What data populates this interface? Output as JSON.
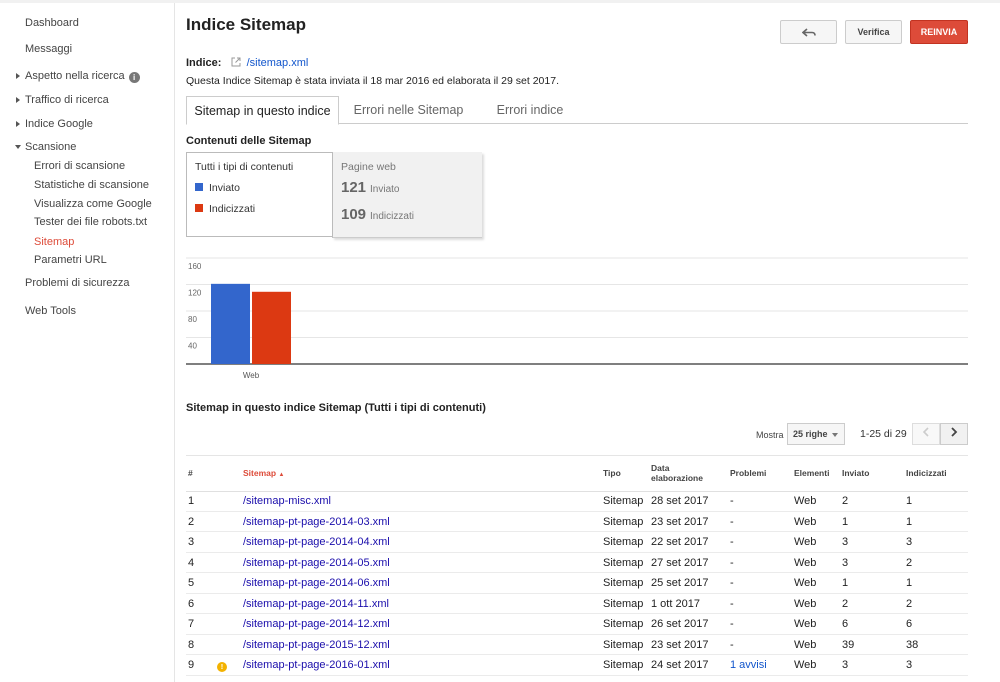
{
  "sidebar": {
    "items": [
      {
        "label": "Dashboard"
      },
      {
        "label": "Messaggi"
      },
      {
        "label": "Aspetto nella ricerca"
      },
      {
        "label": "Traffico di ricerca"
      },
      {
        "label": "Indice Google"
      },
      {
        "label": "Scansione"
      },
      {
        "label": "Problemi di sicurezza"
      },
      {
        "label": "Web Tools"
      }
    ],
    "scansione_sub": [
      {
        "label": "Errori di scansione"
      },
      {
        "label": "Statistiche di scansione"
      },
      {
        "label": "Visualizza come Google"
      },
      {
        "label": "Tester dei file robots.txt"
      },
      {
        "label": "Sitemap"
      },
      {
        "label": "Parametri URL"
      }
    ],
    "info_glyph": "i"
  },
  "header": {
    "title": "Indice Sitemap",
    "verify_label": "Verifica",
    "resend_label": "REINVIA"
  },
  "index": {
    "label": "Indice:",
    "file": "/sitemap.xml",
    "submitted_text": "Questa Indice Sitemap è stata inviata il 18 mar 2016 ed elaborata il 29 set 2017."
  },
  "tabs": [
    {
      "label": "Sitemap in questo indice",
      "active": true
    },
    {
      "label": "Errori nelle Sitemap",
      "active": false
    },
    {
      "label": "Errori indice",
      "active": false
    }
  ],
  "contents": {
    "title": "Contenuti delle Sitemap",
    "legend_title": "Tutti i tipi di contenuti",
    "legend_submitted": "Inviato",
    "legend_indexed": "Indicizzati",
    "web_title": "Pagine web",
    "web_submitted_value": "121",
    "web_submitted_label": "Inviato",
    "web_indexed_value": "109",
    "web_indexed_label": "Indicizzati"
  },
  "colors": {
    "submitted": "#3366cc",
    "indexed": "#dc3912",
    "accent": "#dd4b39",
    "link": "#1a0dab"
  },
  "chart_data": {
    "type": "bar",
    "categories": [
      "Web"
    ],
    "series": [
      {
        "name": "Inviato",
        "values": [
          121
        ]
      },
      {
        "name": "Indicizzati",
        "values": [
          109
        ]
      }
    ],
    "yticks": [
      40,
      80,
      120,
      160
    ],
    "ylim": [
      0,
      160
    ],
    "grid": true
  },
  "table": {
    "title": "Sitemap in questo indice Sitemap (Tutti i tipi di contenuti)",
    "show_label": "Mostra",
    "rows_select": "25 righe",
    "page_range": "1-25 di 29",
    "headers": {
      "num": "#",
      "sitemap": "Sitemap",
      "sort_arrow": "▲",
      "tipo": "Tipo",
      "data_line1": "Data",
      "data_line2": "elaborazione",
      "problemi": "Problemi",
      "elementi": "Elementi",
      "inviato": "Inviato",
      "indicizzati": "Indicizzati"
    },
    "rows": [
      {
        "num": "1",
        "warn": "",
        "sitemap": "/sitemap-misc.xml",
        "tipo": "Sitemap",
        "date": "28 set 2017",
        "problems": "-",
        "elements": "Web",
        "submitted": "2",
        "indexed": "1"
      },
      {
        "num": "2",
        "warn": "",
        "sitemap": "/sitemap-pt-page-2014-03.xml",
        "tipo": "Sitemap",
        "date": "23 set 2017",
        "problems": "-",
        "elements": "Web",
        "submitted": "1",
        "indexed": "1"
      },
      {
        "num": "3",
        "warn": "",
        "sitemap": "/sitemap-pt-page-2014-04.xml",
        "tipo": "Sitemap",
        "date": "22 set 2017",
        "problems": "-",
        "elements": "Web",
        "submitted": "3",
        "indexed": "3"
      },
      {
        "num": "4",
        "warn": "",
        "sitemap": "/sitemap-pt-page-2014-05.xml",
        "tipo": "Sitemap",
        "date": "27 set 2017",
        "problems": "-",
        "elements": "Web",
        "submitted": "3",
        "indexed": "2"
      },
      {
        "num": "5",
        "warn": "",
        "sitemap": "/sitemap-pt-page-2014-06.xml",
        "tipo": "Sitemap",
        "date": "25 set 2017",
        "problems": "-",
        "elements": "Web",
        "submitted": "1",
        "indexed": "1"
      },
      {
        "num": "6",
        "warn": "",
        "sitemap": "/sitemap-pt-page-2014-11.xml",
        "tipo": "Sitemap",
        "date": "1 ott 2017",
        "problems": "-",
        "elements": "Web",
        "submitted": "2",
        "indexed": "2"
      },
      {
        "num": "7",
        "warn": "",
        "sitemap": "/sitemap-pt-page-2014-12.xml",
        "tipo": "Sitemap",
        "date": "26 set 2017",
        "problems": "-",
        "elements": "Web",
        "submitted": "6",
        "indexed": "6"
      },
      {
        "num": "8",
        "warn": "",
        "sitemap": "/sitemap-pt-page-2015-12.xml",
        "tipo": "Sitemap",
        "date": "23 set 2017",
        "problems": "-",
        "elements": "Web",
        "submitted": "39",
        "indexed": "38"
      },
      {
        "num": "9",
        "warn": "!",
        "sitemap": "/sitemap-pt-page-2016-01.xml",
        "tipo": "Sitemap",
        "date": "24 set 2017",
        "problems": "1 avvisi",
        "elements": "Web",
        "submitted": "3",
        "indexed": "3"
      }
    ]
  }
}
